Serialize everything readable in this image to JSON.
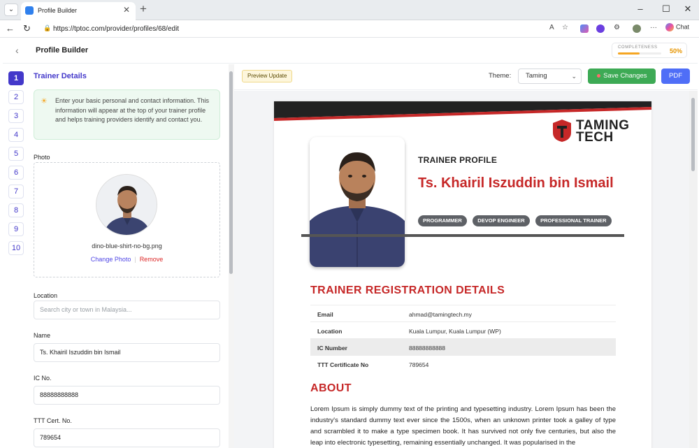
{
  "browser": {
    "tab_title": "Profile Builder",
    "url": "https://tptoc.com/provider/profiles/68/edit",
    "chat_label": "Chat"
  },
  "header": {
    "title": "Profile Builder",
    "completeness_label": "COMPLETENESS",
    "completeness_value": "50%",
    "completeness_fraction": 0.5
  },
  "steps": [
    "1",
    "2",
    "3",
    "4",
    "5",
    "6",
    "7",
    "8",
    "9",
    "10"
  ],
  "form": {
    "heading": "Trainer Details",
    "info": "Enter your basic personal and contact information. This information will appear at the top of your trainer profile and helps training providers identify and contact you.",
    "photo_label": "Photo",
    "photo_filename": "dino-blue-shirt-no-bg.png",
    "change_photo": "Change Photo",
    "remove": "Remove",
    "location_label": "Location",
    "location_placeholder": "Search city or town in Malaysia...",
    "name_label": "Name",
    "name_value": "Ts. Khairil Iszuddin bin Ismail",
    "ic_label": "IC No.",
    "ic_value": "88888888888",
    "ttt_label": "TTT Cert. No.",
    "ttt_value": "789654"
  },
  "toolbar": {
    "preview_update": "Preview Update",
    "theme_label": "Theme:",
    "theme_value": "Taming",
    "save_changes": "Save Changes",
    "pdf": "PDF"
  },
  "preview": {
    "logo_line1": "TAMING",
    "logo_line2": "TECH",
    "trainer_profile": "TRAINER PROFILE",
    "name": "Ts. Khairil Iszuddin bin Ismail",
    "tags": [
      "PROGRAMMER",
      "DEVOP ENGINEER",
      "PROFESSIONAL TRAINER"
    ],
    "registration_title": "TRAINER REGISTRATION DETAILS",
    "details": [
      {
        "key": "Email",
        "value": "ahmad@tamingtech.my"
      },
      {
        "key": "Location",
        "value": "Kuala Lumpur, Kuala Lumpur (WP)"
      },
      {
        "key": "IC Number",
        "value": "88888888888"
      },
      {
        "key": "TTT Certificate No",
        "value": "789654"
      }
    ],
    "about_title": "ABOUT",
    "about_text": "Lorem Ipsum is simply dummy text of the printing and typesetting industry. Lorem Ipsum has been the industry's standard dummy text ever since the 1500s, when an unknown printer took a galley of type and scrambled it to make a type specimen book. It has survived not only five centuries, but also the leap into electronic typesetting, remaining essentially unchanged. It was popularised in the"
  },
  "colors": {
    "accent": "#4338ca",
    "brand_red": "#c62828",
    "save_green": "#3daa55",
    "pdf_blue": "#4f6ef7",
    "progress": "#f5a623"
  }
}
